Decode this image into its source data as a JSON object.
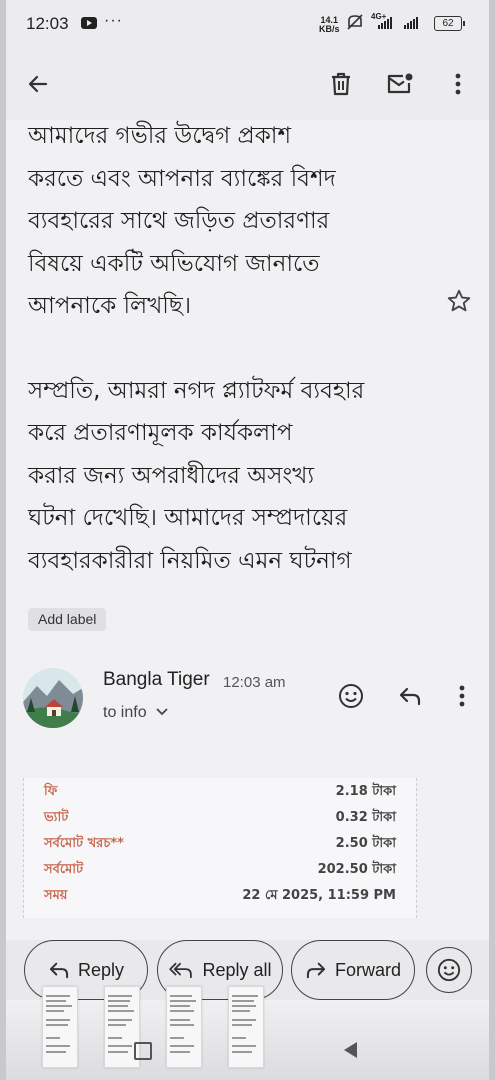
{
  "status_bar": {
    "time": "12:03",
    "more": "···",
    "speed_value": "14.1",
    "speed_unit": "KB/s",
    "network": "4G+",
    "battery": "62"
  },
  "toolbar": {
    "back_icon": "arrow-left-icon",
    "delete_icon": "trash-icon",
    "mark_unread_icon": "mail-dot-icon",
    "more_icon": "more-vertical-icon"
  },
  "email": {
    "body_paragraph_1": [
      "আমাদের গভীর উদ্বেগ প্রকাশ",
      "করতে এবং আপনার ব্যাঙ্কের বিশদ",
      "ব্যবহারের সাথে জড়িত প্রতারণার",
      "বিষয়ে একটি অভিযোগ জানাতে",
      "আপনাকে লিখছি।"
    ],
    "body_paragraph_2": [
      "সম্প্রতি, আমরা নগদ প্ল্যাটফর্ম ব্যবহার",
      "করে প্রতারণামূলক কার্যকলাপ",
      "করার জন্য অপরাধীদের অসংখ্য",
      "ঘটনা দেখেছি। আমাদের সম্প্রদায়ের",
      "ব্যবহারকারীরা নিয়মিত এমন ঘটনাগ"
    ],
    "add_label": "Add label"
  },
  "message": {
    "sender": "Bangla Tiger",
    "time": "12:03 am",
    "to": "to info",
    "receipt": [
      {
        "label": "ফি",
        "value": "2.18 টাকা"
      },
      {
        "label": "ভ্যাট",
        "value": "0.32 টাকা"
      },
      {
        "label": "সর্বমোট খরচ**",
        "value": "2.50 টাকা"
      },
      {
        "label": "সর্বমোট",
        "value": "202.50 টাকা"
      },
      {
        "label": "সময়",
        "value": "22 মে 2025, 11:59 PM"
      }
    ]
  },
  "actions": {
    "reply": "Reply",
    "reply_all": "Reply all",
    "forward": "Forward"
  },
  "colors": {
    "receipt_label": "#c8674f",
    "background": "#f1f1f4"
  }
}
